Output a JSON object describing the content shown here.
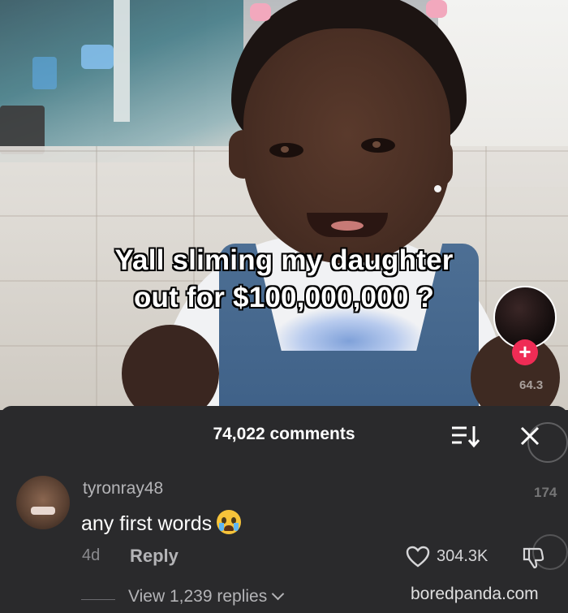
{
  "video": {
    "caption_line1": "Yall sliming my daughter",
    "caption_line2": "out for $100,000,000 ?",
    "follow_symbol": "+",
    "side_count_partial": "64.3"
  },
  "comments_sheet": {
    "count_label": "74,022 comments",
    "sort_icon": "sort-list-icon",
    "close_icon": "close-icon",
    "ghost_count": "174",
    "comment": {
      "username": "tyronray48",
      "text": "any first words",
      "emoji": "loudly-crying-face",
      "time": "4d",
      "reply_label": "Reply",
      "likes": "304.3K",
      "view_replies": "View 1,239 replies"
    },
    "watermark": "boredpanda.com"
  },
  "colors": {
    "sheet_bg": "#2a2a2c",
    "follow_accent": "#ef2c55",
    "caption_text": "#ffffff"
  }
}
